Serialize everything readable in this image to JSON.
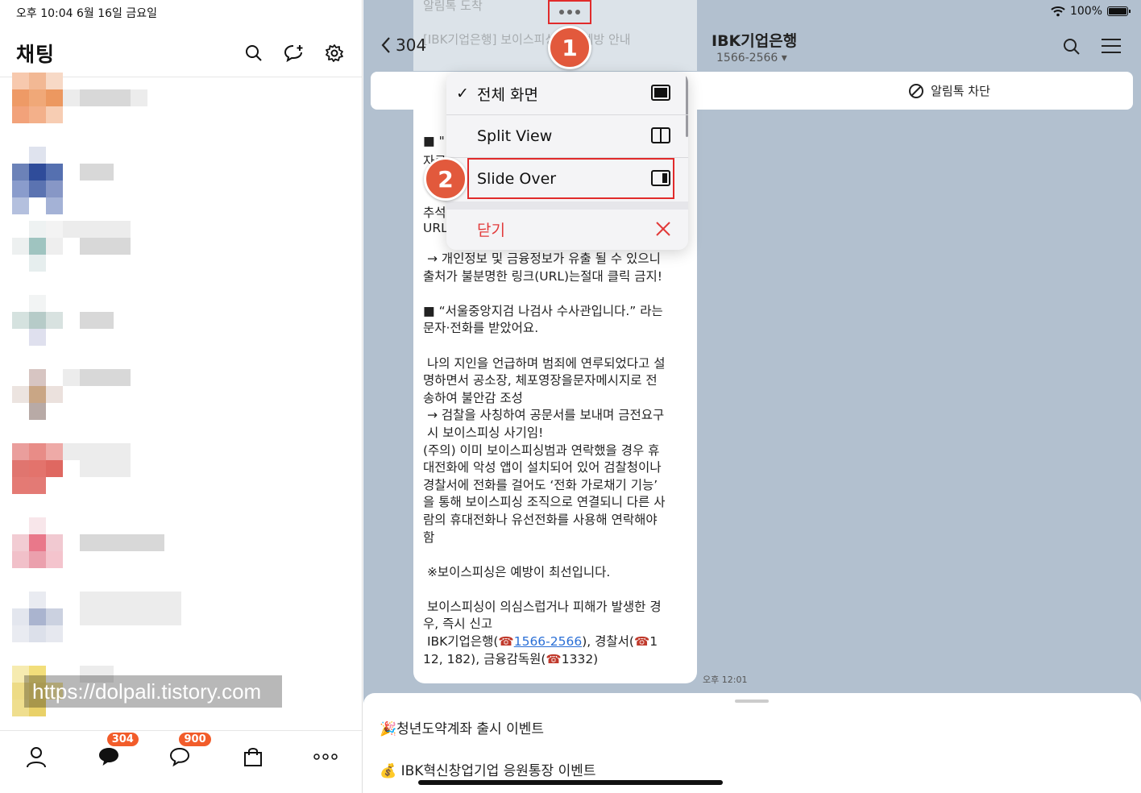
{
  "status": {
    "time_date": "오후 10:04   6월 16일 금요일",
    "battery": "100%"
  },
  "left": {
    "title": "채팅",
    "watermark": "https://dolpali.tistory.com",
    "nav": {
      "chat_badge": "304",
      "open_chat_badge": "900"
    }
  },
  "right": {
    "back_count": "304",
    "room_title": "IBK기업은행",
    "room_phone": "1566-2566",
    "block_label": "알림톡 차단",
    "faded_line1": "[IBK기업은행] 보이스피싱 피해예방 안내",
    "faded_line0": "알림톡 도착",
    "bubble_frag1": "■ \"",
    "bubble_frag2": "자료",
    "bubble_frag3": "추석",
    "bubble_frag4": "URL",
    "bubble_text_a": " → 개인정보 및 금융정보가 유출 될 수 있으니\n출처가 불분명한 링크(URL)는절대 클릭 금지!\n\n■ “서울중앙지검 나검사 수사관입니다.” 라는\n문자·전화를 받았어요.\n\n 나의 지인을 언급하며 범죄에 연루되었다고 설\n명하면서 공소장, 체포영장을문자메시지로 전\n송하여 불안감 조성\n → 검찰을 사칭하여 공문서를 보내며 금전요구\n 시 보이스피싱 사기임!\n(주의) 이미 보이스피싱범과 연락했을 경우 휴\n대전화에 악성 앱이 설치되어 있어 검찰청이나\n경찰서에 전화를 걸어도 ‘전화 가로채기 기능’\n을 통해 보이스피싱 조직으로 연결되니 다른 사\n람의 휴대전화나 유선전화를 사용해 연락해야\n함\n\n ※보이스피싱은 예방이 최선입니다.\n\n 보이스피싱이 의심스럽거나 피해가 발생한 경\n우, 즉시 신고\n IBK기업은행(",
    "link_phone": "1566-2566",
    "bubble_text_b": "), 경찰서(",
    "bubble_text_c": "1\n12, 182), 금융감독원(",
    "bubble_text_d": "1332)",
    "phone_emoji": "☎",
    "time": "오후 12:01",
    "sheet_items": [
      "🎉청년도약계좌 출시 이벤트",
      "💰 IBK혁신창업기업 응원통장 이벤트"
    ]
  },
  "multitask_menu": {
    "items": [
      {
        "label": "전체 화면",
        "checked": true
      },
      {
        "label": "Split View",
        "checked": false
      },
      {
        "label": "Slide Over",
        "checked": false
      }
    ],
    "close_label": "닫기",
    "step1": "1",
    "step2": "2"
  },
  "colors": {
    "accent": "#e2593c",
    "highlight": "#e12b2b",
    "chat_bg": "#b2c0cf",
    "badge": "#f25c2a"
  }
}
